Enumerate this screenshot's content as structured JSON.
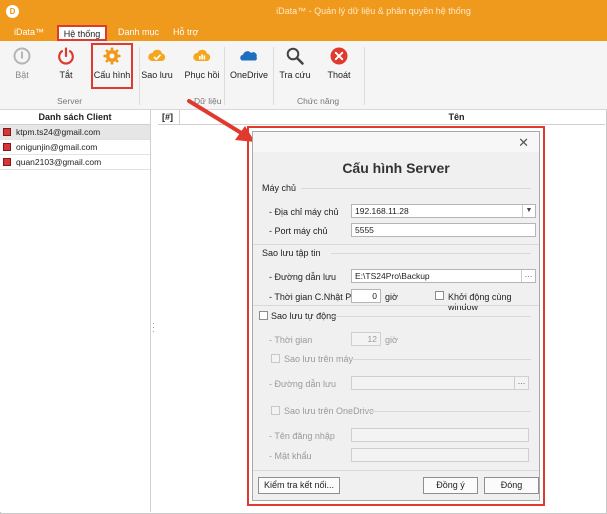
{
  "window": {
    "logo": "D",
    "title": "iData™ - Quản lý dữ liệu & phân quyền hệ thống"
  },
  "menu": {
    "app": "iData™",
    "items": [
      "Hệ thống",
      "Danh mục",
      "Hỗ trợ"
    ]
  },
  "ribbon": {
    "buttons": [
      {
        "label": "Bật",
        "icon": "power-on-icon"
      },
      {
        "label": "Tắt",
        "icon": "power-off-icon"
      },
      {
        "label": "Cấu hình",
        "icon": "gear-icon"
      },
      {
        "label": "Sao lưu",
        "icon": "cloud-upload-icon"
      },
      {
        "label": "Phục hồi",
        "icon": "cloud-download-icon"
      },
      {
        "label": "OneDrive",
        "icon": "onedrive-icon"
      },
      {
        "label": "Tra cứu",
        "icon": "search-icon"
      },
      {
        "label": "Thoát",
        "icon": "exit-icon"
      }
    ],
    "groups": [
      "Server",
      "Dữ liệu",
      "Chức năng"
    ]
  },
  "client_list": {
    "header": "Danh sách Client",
    "items": [
      "ktpm.ts24@gmail.com",
      "onigunjin@gmail.com",
      "quan2103@gmail.com"
    ]
  },
  "grid": {
    "col_hash": "[#]",
    "col_name": "Tên"
  },
  "dialog": {
    "title": "Cấu hình Server",
    "sec_server": "Máy chủ",
    "host_label": "- Địa chỉ máy chủ",
    "host_value": "192.168.11.28",
    "port_label": "- Port máy chủ",
    "port_value": "5555",
    "sec_backup": "Sao lưu tập tin",
    "path_label": "- Đường dẫn lưu",
    "path_value": "E:\\TS24Pro\\Backup",
    "time_label": "- Thời gian C.Nhật P.M",
    "time_value": "0",
    "time_unit": "giờ",
    "startup_label": "Khởi động cùng window",
    "auto_label": "Sao lưu tự động",
    "auto_time_label": "- Thời gian",
    "auto_time_value": "12",
    "auto_time_unit": "giờ",
    "on_machine_label": "Sao lưu trên máy",
    "auto_path_label": "- Đường dẫn lưu",
    "on_onedrive_label": "Sao lưu trên OneDrive",
    "username_label": "- Tên đăng nhập",
    "password_label": "- Mật khẩu",
    "test_btn": "Kiểm tra kết nối...",
    "ok_btn": "Đồng ý",
    "close_btn": "Đóng"
  },
  "colors": {
    "accent": "#f09a1d",
    "highlight": "#e03a2f"
  }
}
